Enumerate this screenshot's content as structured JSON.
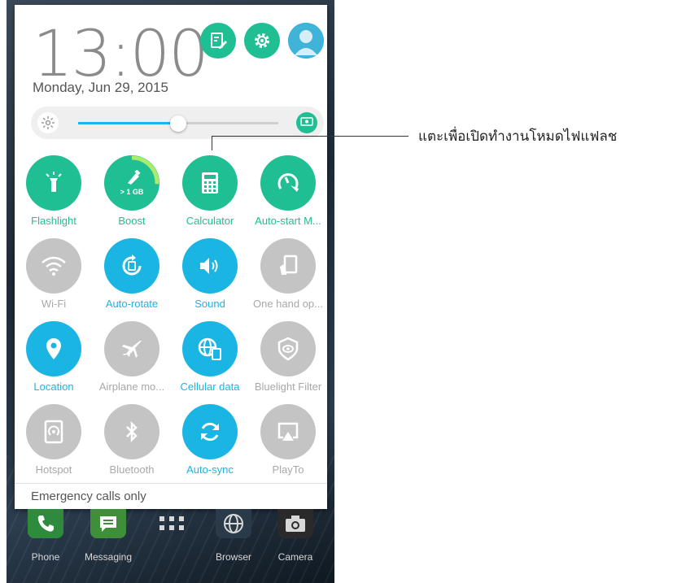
{
  "clock": {
    "time": "13:00",
    "date": "Monday, Jun 29, 2015"
  },
  "top_icons": [
    "edit-icon",
    "settings-icon",
    "avatar-icon"
  ],
  "brightness": {
    "level": 0.5,
    "auto_label": "AUTO"
  },
  "tiles": [
    {
      "label": "Flashlight",
      "icon": "flashlight-icon",
      "state": "green"
    },
    {
      "label": "Boost",
      "icon": "boost-icon",
      "state": "green",
      "badge": "> 1 GB"
    },
    {
      "label": "Calculator",
      "icon": "calculator-icon",
      "state": "green"
    },
    {
      "label": "Auto-start M...",
      "icon": "auto-start-icon",
      "state": "green"
    },
    {
      "label": "Wi-Fi",
      "icon": "wifi-icon",
      "state": "gray"
    },
    {
      "label": "Auto-rotate",
      "icon": "auto-rotate-icon",
      "state": "blue"
    },
    {
      "label": "Sound",
      "icon": "sound-icon",
      "state": "blue"
    },
    {
      "label": "One hand op...",
      "icon": "one-hand-icon",
      "state": "gray"
    },
    {
      "label": "Location",
      "icon": "location-icon",
      "state": "blue"
    },
    {
      "label": "Airplane mo...",
      "icon": "airplane-icon",
      "state": "gray"
    },
    {
      "label": "Cellular data",
      "icon": "cellular-data-icon",
      "state": "blue"
    },
    {
      "label": "Bluelight Filter",
      "icon": "bluelight-icon",
      "state": "gray"
    },
    {
      "label": "Hotspot",
      "icon": "hotspot-icon",
      "state": "gray"
    },
    {
      "label": "Bluetooth",
      "icon": "bluetooth-icon",
      "state": "gray"
    },
    {
      "label": "Auto-sync",
      "icon": "sync-icon",
      "state": "blue"
    },
    {
      "label": "PlayTo",
      "icon": "playto-icon",
      "state": "gray"
    }
  ],
  "emergency": "Emergency calls only",
  "dock": [
    {
      "label": "Phone",
      "icon": "phone-icon",
      "color": "#2e8a3c"
    },
    {
      "label": "Messaging",
      "icon": "messaging-icon",
      "color": "#3f8f3a"
    },
    {
      "label": "",
      "icon": "app-drawer-icon",
      "color": ""
    },
    {
      "label": "Browser",
      "icon": "globe-icon",
      "color": "#2a3a48"
    },
    {
      "label": "Camera",
      "icon": "camera-icon",
      "color": "#2a2a2a"
    }
  ],
  "callout": "แตะเพื่อเปิดทำงานโหมดไฟแฟลช",
  "colors": {
    "green": "#1fbf93",
    "blue": "#1ab5e3",
    "gray": "#c4c4c4"
  }
}
